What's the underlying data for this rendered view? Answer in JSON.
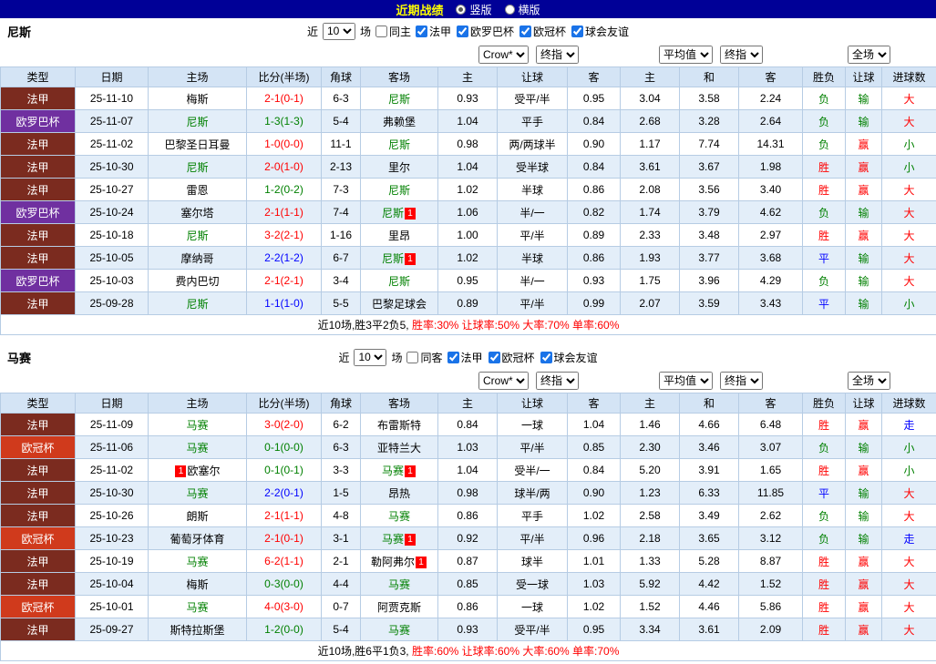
{
  "topbar": {
    "title": "近期战绩",
    "radios": [
      {
        "label": "竖版",
        "selected": true
      },
      {
        "label": "横版",
        "selected": false
      }
    ]
  },
  "sections": [
    {
      "team": "尼斯",
      "filters": {
        "near": "近",
        "count": "10",
        "games": "场",
        "same": {
          "label": "同主",
          "checked": false
        },
        "leagues": [
          {
            "label": "法甲",
            "checked": true
          },
          {
            "label": "欧罗巴杯",
            "checked": true
          },
          {
            "label": "欧冠杯",
            "checked": true
          },
          {
            "label": "球会友谊",
            "checked": true
          }
        ]
      },
      "dropdowns": {
        "bookmaker": "Crow*",
        "final_a": "终指",
        "average": "平均值",
        "final_b": "终指",
        "scope": "全场"
      },
      "headers": [
        "类型",
        "日期",
        "主场",
        "比分(半场)",
        "角球",
        "客场",
        "主",
        "让球",
        "客",
        "主",
        "和",
        "客",
        "胜负",
        "让球",
        "进球数"
      ],
      "rows": [
        {
          "league": "法甲",
          "lc": "fa",
          "date": "25-11-10",
          "home": {
            "name": "梅斯",
            "focal": false,
            "card": ""
          },
          "score": "2-1(0-1)",
          "sc": "red",
          "corner": "6-3",
          "away": {
            "name": "尼斯",
            "focal": true,
            "card": ""
          },
          "asia": [
            "0.93",
            "受平/半",
            "0.95"
          ],
          "euro": [
            "3.04",
            "3.58",
            "2.24"
          ],
          "res": [
            [
              "负",
              "green"
            ],
            [
              "输",
              "green"
            ],
            [
              "大",
              "red"
            ]
          ]
        },
        {
          "league": "欧罗巴杯",
          "lc": "ol",
          "date": "25-11-07",
          "home": {
            "name": "尼斯",
            "focal": true,
            "card": ""
          },
          "score": "1-3(1-3)",
          "sc": "green",
          "corner": "5-4",
          "away": {
            "name": "弗赖堡",
            "focal": false,
            "card": ""
          },
          "asia": [
            "1.04",
            "平手",
            "0.84"
          ],
          "euro": [
            "2.68",
            "3.28",
            "2.64"
          ],
          "res": [
            [
              "负",
              "green"
            ],
            [
              "输",
              "green"
            ],
            [
              "大",
              "red"
            ]
          ]
        },
        {
          "league": "法甲",
          "lc": "fa",
          "date": "25-11-02",
          "home": {
            "name": "巴黎圣日耳曼",
            "focal": false,
            "card": ""
          },
          "score": "1-0(0-0)",
          "sc": "red",
          "corner": "11-1",
          "away": {
            "name": "尼斯",
            "focal": true,
            "card": ""
          },
          "asia": [
            "0.98",
            "两/两球半",
            "0.90"
          ],
          "euro": [
            "1.17",
            "7.74",
            "14.31"
          ],
          "res": [
            [
              "负",
              "green"
            ],
            [
              "赢",
              "red"
            ],
            [
              "小",
              "green"
            ]
          ]
        },
        {
          "league": "法甲",
          "lc": "fa",
          "date": "25-10-30",
          "home": {
            "name": "尼斯",
            "focal": true,
            "card": ""
          },
          "score": "2-0(1-0)",
          "sc": "red",
          "corner": "2-13",
          "away": {
            "name": "里尔",
            "focal": false,
            "card": ""
          },
          "asia": [
            "1.04",
            "受半球",
            "0.84"
          ],
          "euro": [
            "3.61",
            "3.67",
            "1.98"
          ],
          "res": [
            [
              "胜",
              "red"
            ],
            [
              "赢",
              "red"
            ],
            [
              "小",
              "green"
            ]
          ]
        },
        {
          "league": "法甲",
          "lc": "fa",
          "date": "25-10-27",
          "home": {
            "name": "雷恩",
            "focal": false,
            "card": ""
          },
          "score": "1-2(0-2)",
          "sc": "green",
          "corner": "7-3",
          "away": {
            "name": "尼斯",
            "focal": true,
            "card": ""
          },
          "asia": [
            "1.02",
            "半球",
            "0.86"
          ],
          "euro": [
            "2.08",
            "3.56",
            "3.40"
          ],
          "res": [
            [
              "胜",
              "red"
            ],
            [
              "赢",
              "red"
            ],
            [
              "大",
              "red"
            ]
          ]
        },
        {
          "league": "欧罗巴杯",
          "lc": "ol",
          "date": "25-10-24",
          "home": {
            "name": "塞尔塔",
            "focal": false,
            "card": ""
          },
          "score": "2-1(1-1)",
          "sc": "red",
          "corner": "7-4",
          "away": {
            "name": "尼斯",
            "focal": true,
            "card": "1"
          },
          "asia": [
            "1.06",
            "半/一",
            "0.82"
          ],
          "euro": [
            "1.74",
            "3.79",
            "4.62"
          ],
          "res": [
            [
              "负",
              "green"
            ],
            [
              "输",
              "green"
            ],
            [
              "大",
              "red"
            ]
          ]
        },
        {
          "league": "法甲",
          "lc": "fa",
          "date": "25-10-18",
          "home": {
            "name": "尼斯",
            "focal": true,
            "card": ""
          },
          "score": "3-2(2-1)",
          "sc": "red",
          "corner": "1-16",
          "away": {
            "name": "里昂",
            "focal": false,
            "card": ""
          },
          "asia": [
            "1.00",
            "平/半",
            "0.89"
          ],
          "euro": [
            "2.33",
            "3.48",
            "2.97"
          ],
          "res": [
            [
              "胜",
              "red"
            ],
            [
              "赢",
              "red"
            ],
            [
              "大",
              "red"
            ]
          ]
        },
        {
          "league": "法甲",
          "lc": "fa",
          "date": "25-10-05",
          "home": {
            "name": "摩纳哥",
            "focal": false,
            "card": ""
          },
          "score": "2-2(1-2)",
          "sc": "blue",
          "corner": "6-7",
          "away": {
            "name": "尼斯",
            "focal": true,
            "card": "1"
          },
          "asia": [
            "1.02",
            "半球",
            "0.86"
          ],
          "euro": [
            "1.93",
            "3.77",
            "3.68"
          ],
          "res": [
            [
              "平",
              "blue"
            ],
            [
              "输",
              "green"
            ],
            [
              "大",
              "red"
            ]
          ]
        },
        {
          "league": "欧罗巴杯",
          "lc": "ol",
          "date": "25-10-03",
          "home": {
            "name": "费内巴切",
            "focal": false,
            "card": ""
          },
          "score": "2-1(2-1)",
          "sc": "red",
          "corner": "3-4",
          "away": {
            "name": "尼斯",
            "focal": true,
            "card": ""
          },
          "asia": [
            "0.95",
            "半/一",
            "0.93"
          ],
          "euro": [
            "1.75",
            "3.96",
            "4.29"
          ],
          "res": [
            [
              "负",
              "green"
            ],
            [
              "输",
              "green"
            ],
            [
              "大",
              "red"
            ]
          ]
        },
        {
          "league": "法甲",
          "lc": "fa",
          "date": "25-09-28",
          "home": {
            "name": "尼斯",
            "focal": true,
            "card": ""
          },
          "score": "1-1(1-0)",
          "sc": "blue",
          "corner": "5-5",
          "away": {
            "name": "巴黎足球会",
            "focal": false,
            "card": ""
          },
          "asia": [
            "0.89",
            "平/半",
            "0.99"
          ],
          "euro": [
            "2.07",
            "3.59",
            "3.43"
          ],
          "res": [
            [
              "平",
              "blue"
            ],
            [
              "输",
              "green"
            ],
            [
              "小",
              "green"
            ]
          ]
        }
      ],
      "summary": {
        "record": "近10场,胜3平2负5,",
        "rates": "胜率:30% 让球率:50% 大率:70% 单率:60%"
      }
    },
    {
      "team": "马赛",
      "filters": {
        "near": "近",
        "count": "10",
        "games": "场",
        "same": {
          "label": "同客",
          "checked": false
        },
        "leagues": [
          {
            "label": "法甲",
            "checked": true
          },
          {
            "label": "欧冠杯",
            "checked": true
          },
          {
            "label": "球会友谊",
            "checked": true
          }
        ]
      },
      "dropdowns": {
        "bookmaker": "Crow*",
        "final_a": "终指",
        "average": "平均值",
        "final_b": "终指",
        "scope": "全场"
      },
      "headers": [
        "类型",
        "日期",
        "主场",
        "比分(半场)",
        "角球",
        "客场",
        "主",
        "让球",
        "客",
        "主",
        "和",
        "客",
        "胜负",
        "让球",
        "进球数"
      ],
      "rows": [
        {
          "league": "法甲",
          "lc": "fa",
          "date": "25-11-09",
          "home": {
            "name": "马赛",
            "focal": true,
            "card": ""
          },
          "score": "3-0(2-0)",
          "sc": "red",
          "corner": "6-2",
          "away": {
            "name": "布雷斯特",
            "focal": false,
            "card": ""
          },
          "asia": [
            "0.84",
            "一球",
            "1.04"
          ],
          "euro": [
            "1.46",
            "4.66",
            "6.48"
          ],
          "res": [
            [
              "胜",
              "red"
            ],
            [
              "赢",
              "red"
            ],
            [
              "走",
              "blue"
            ]
          ]
        },
        {
          "league": "欧冠杯",
          "lc": "og",
          "date": "25-11-06",
          "home": {
            "name": "马赛",
            "focal": true,
            "card": ""
          },
          "score": "0-1(0-0)",
          "sc": "green",
          "corner": "6-3",
          "away": {
            "name": "亚特兰大",
            "focal": false,
            "card": ""
          },
          "asia": [
            "1.03",
            "平/半",
            "0.85"
          ],
          "euro": [
            "2.30",
            "3.46",
            "3.07"
          ],
          "res": [
            [
              "负",
              "green"
            ],
            [
              "输",
              "green"
            ],
            [
              "小",
              "green"
            ]
          ]
        },
        {
          "league": "法甲",
          "lc": "fa",
          "date": "25-11-02",
          "home": {
            "name": "欧塞尔",
            "focal": false,
            "card": "1"
          },
          "score": "0-1(0-1)",
          "sc": "green",
          "corner": "3-3",
          "away": {
            "name": "马赛",
            "focal": true,
            "card": "1"
          },
          "asia": [
            "1.04",
            "受半/一",
            "0.84"
          ],
          "euro": [
            "5.20",
            "3.91",
            "1.65"
          ],
          "res": [
            [
              "胜",
              "red"
            ],
            [
              "赢",
              "red"
            ],
            [
              "小",
              "green"
            ]
          ]
        },
        {
          "league": "法甲",
          "lc": "fa",
          "date": "25-10-30",
          "home": {
            "name": "马赛",
            "focal": true,
            "card": ""
          },
          "score": "2-2(0-1)",
          "sc": "blue",
          "corner": "1-5",
          "away": {
            "name": "昂热",
            "focal": false,
            "card": ""
          },
          "asia": [
            "0.98",
            "球半/两",
            "0.90"
          ],
          "euro": [
            "1.23",
            "6.33",
            "11.85"
          ],
          "res": [
            [
              "平",
              "blue"
            ],
            [
              "输",
              "green"
            ],
            [
              "大",
              "red"
            ]
          ]
        },
        {
          "league": "法甲",
          "lc": "fa",
          "date": "25-10-26",
          "home": {
            "name": "朗斯",
            "focal": false,
            "card": ""
          },
          "score": "2-1(1-1)",
          "sc": "red",
          "corner": "4-8",
          "away": {
            "name": "马赛",
            "focal": true,
            "card": ""
          },
          "asia": [
            "0.86",
            "平手",
            "1.02"
          ],
          "euro": [
            "2.58",
            "3.49",
            "2.62"
          ],
          "res": [
            [
              "负",
              "green"
            ],
            [
              "输",
              "green"
            ],
            [
              "大",
              "red"
            ]
          ]
        },
        {
          "league": "欧冠杯",
          "lc": "og",
          "date": "25-10-23",
          "home": {
            "name": "葡萄牙体育",
            "focal": false,
            "card": ""
          },
          "score": "2-1(0-1)",
          "sc": "red",
          "corner": "3-1",
          "away": {
            "name": "马赛",
            "focal": true,
            "card": "1"
          },
          "asia": [
            "0.92",
            "平/半",
            "0.96"
          ],
          "euro": [
            "2.18",
            "3.65",
            "3.12"
          ],
          "res": [
            [
              "负",
              "green"
            ],
            [
              "输",
              "green"
            ],
            [
              "走",
              "blue"
            ]
          ]
        },
        {
          "league": "法甲",
          "lc": "fa",
          "date": "25-10-19",
          "home": {
            "name": "马赛",
            "focal": true,
            "card": ""
          },
          "score": "6-2(1-1)",
          "sc": "red",
          "corner": "2-1",
          "away": {
            "name": "勒阿弗尔",
            "focal": false,
            "card": "1"
          },
          "asia": [
            "0.87",
            "球半",
            "1.01"
          ],
          "euro": [
            "1.33",
            "5.28",
            "8.87"
          ],
          "res": [
            [
              "胜",
              "red"
            ],
            [
              "赢",
              "red"
            ],
            [
              "大",
              "red"
            ]
          ]
        },
        {
          "league": "法甲",
          "lc": "fa",
          "date": "25-10-04",
          "home": {
            "name": "梅斯",
            "focal": false,
            "card": ""
          },
          "score": "0-3(0-0)",
          "sc": "green",
          "corner": "4-4",
          "away": {
            "name": "马赛",
            "focal": true,
            "card": ""
          },
          "asia": [
            "0.85",
            "受一球",
            "1.03"
          ],
          "euro": [
            "5.92",
            "4.42",
            "1.52"
          ],
          "res": [
            [
              "胜",
              "red"
            ],
            [
              "赢",
              "red"
            ],
            [
              "大",
              "red"
            ]
          ]
        },
        {
          "league": "欧冠杯",
          "lc": "og",
          "date": "25-10-01",
          "home": {
            "name": "马赛",
            "focal": true,
            "card": ""
          },
          "score": "4-0(3-0)",
          "sc": "red",
          "corner": "0-7",
          "away": {
            "name": "阿贾克斯",
            "focal": false,
            "card": ""
          },
          "asia": [
            "0.86",
            "一球",
            "1.02"
          ],
          "euro": [
            "1.52",
            "4.46",
            "5.86"
          ],
          "res": [
            [
              "胜",
              "red"
            ],
            [
              "赢",
              "red"
            ],
            [
              "大",
              "red"
            ]
          ]
        },
        {
          "league": "法甲",
          "lc": "fa",
          "date": "25-09-27",
          "home": {
            "name": "斯特拉斯堡",
            "focal": false,
            "card": ""
          },
          "score": "1-2(0-0)",
          "sc": "green",
          "corner": "5-4",
          "away": {
            "name": "马赛",
            "focal": true,
            "card": ""
          },
          "asia": [
            "0.93",
            "受平/半",
            "0.95"
          ],
          "euro": [
            "3.34",
            "3.61",
            "2.09"
          ],
          "res": [
            [
              "胜",
              "red"
            ],
            [
              "赢",
              "red"
            ],
            [
              "大",
              "red"
            ]
          ]
        }
      ],
      "summary": {
        "record": "近10场,胜6平1负3,",
        "rates": "胜率:60% 让球率:60% 大率:60% 单率:70%"
      }
    }
  ]
}
